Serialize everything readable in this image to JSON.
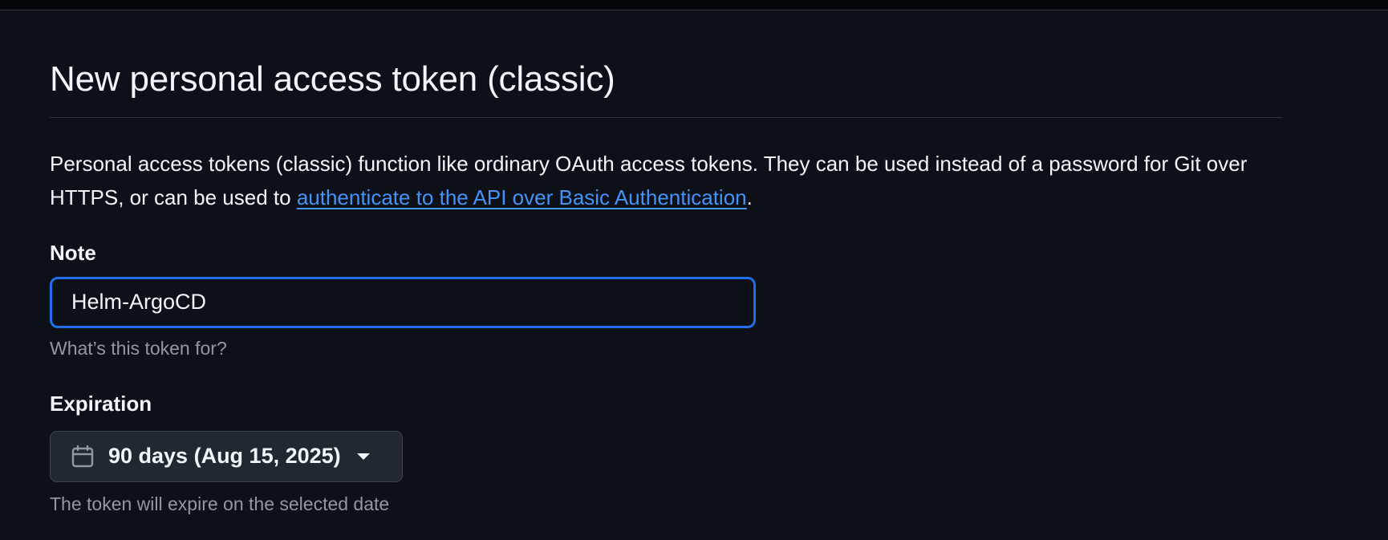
{
  "header": {
    "title": "New personal access token (classic)"
  },
  "description": {
    "text_before": "Personal access tokens (classic) function like ordinary OAuth access tokens. They can be used instead of a password for Git over HTTPS, or can be used to ",
    "link_text": "authenticate to the API over Basic Authentication",
    "text_after": "."
  },
  "note": {
    "label": "Note",
    "value": "Helm-ArgoCD",
    "hint": "What’s this token for?"
  },
  "expiration": {
    "label": "Expiration",
    "selected": "90 days (Aug 15, 2025)",
    "hint": "The token will expire on the selected date",
    "icon": "calendar-icon"
  },
  "colors": {
    "background": "#0d1117",
    "link": "#4493f8",
    "focus_border": "#1f6feb",
    "muted_text": "#9198a1"
  }
}
